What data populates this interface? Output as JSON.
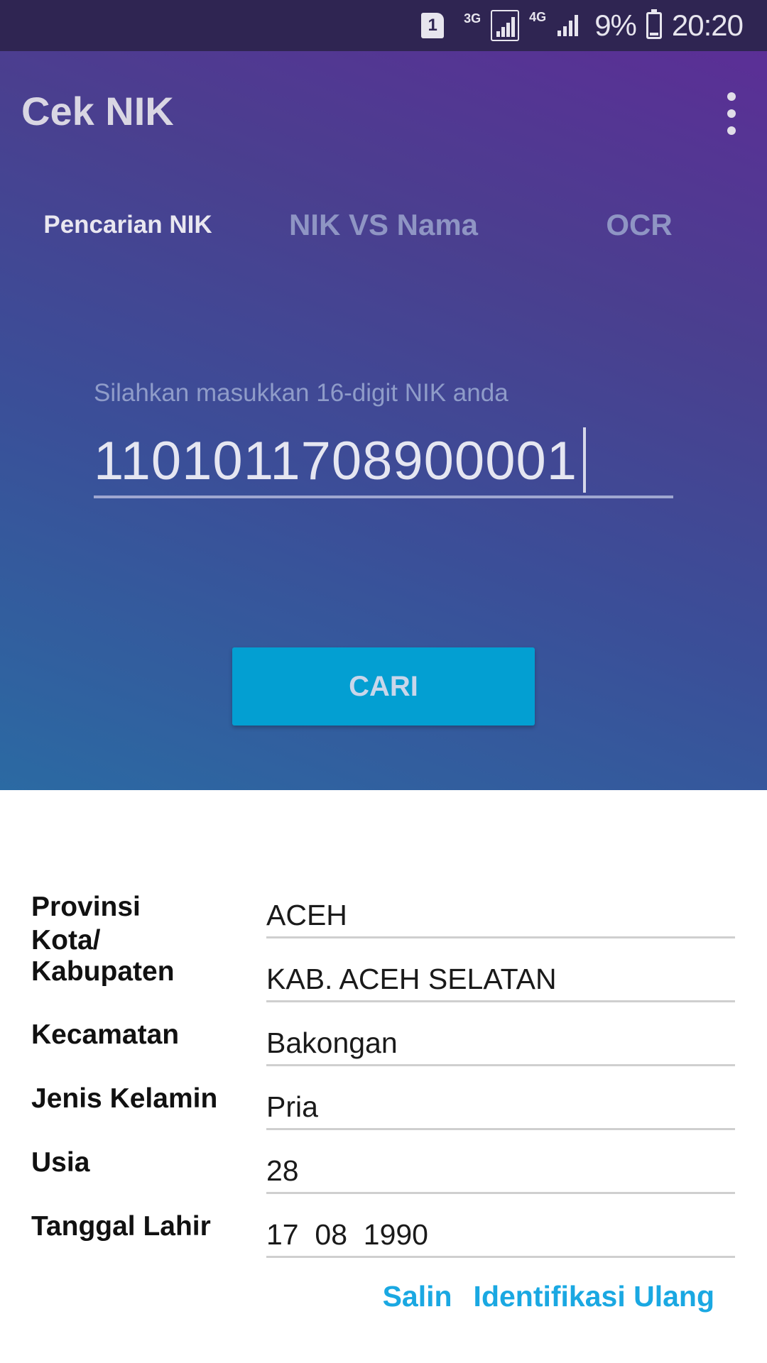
{
  "status_bar": {
    "sim": "1",
    "net_3g": "3G",
    "net_4g": "4G",
    "battery": "9%",
    "time": "20:20"
  },
  "app": {
    "title": "Cek NIK"
  },
  "tabs": [
    {
      "label": "Pencarian NIK",
      "active": true
    },
    {
      "label": "NIK VS Nama",
      "active": false
    },
    {
      "label": "OCR",
      "active": false
    }
  ],
  "search": {
    "label": "Silahkan masukkan 16-digit NIK anda",
    "value": "1101011708900001",
    "button": "CARI"
  },
  "results": {
    "rows": [
      {
        "label": "Provinsi",
        "value": "ACEH"
      },
      {
        "label": "Kota/ Kabupaten",
        "value": "KAB. ACEH SELATAN"
      },
      {
        "label": "Kecamatan",
        "value": "Bakongan"
      },
      {
        "label": "Jenis Kelamin",
        "value": "Pria"
      },
      {
        "label": "Usia",
        "value": "28"
      },
      {
        "label": "Tanggal Lahir",
        "value": "17  08  1990"
      }
    ],
    "actions": {
      "copy": "Salin",
      "reidentify": "Identifikasi Ulang"
    }
  },
  "colors": {
    "accent": "#039fd2",
    "link": "#1aa8e2"
  }
}
